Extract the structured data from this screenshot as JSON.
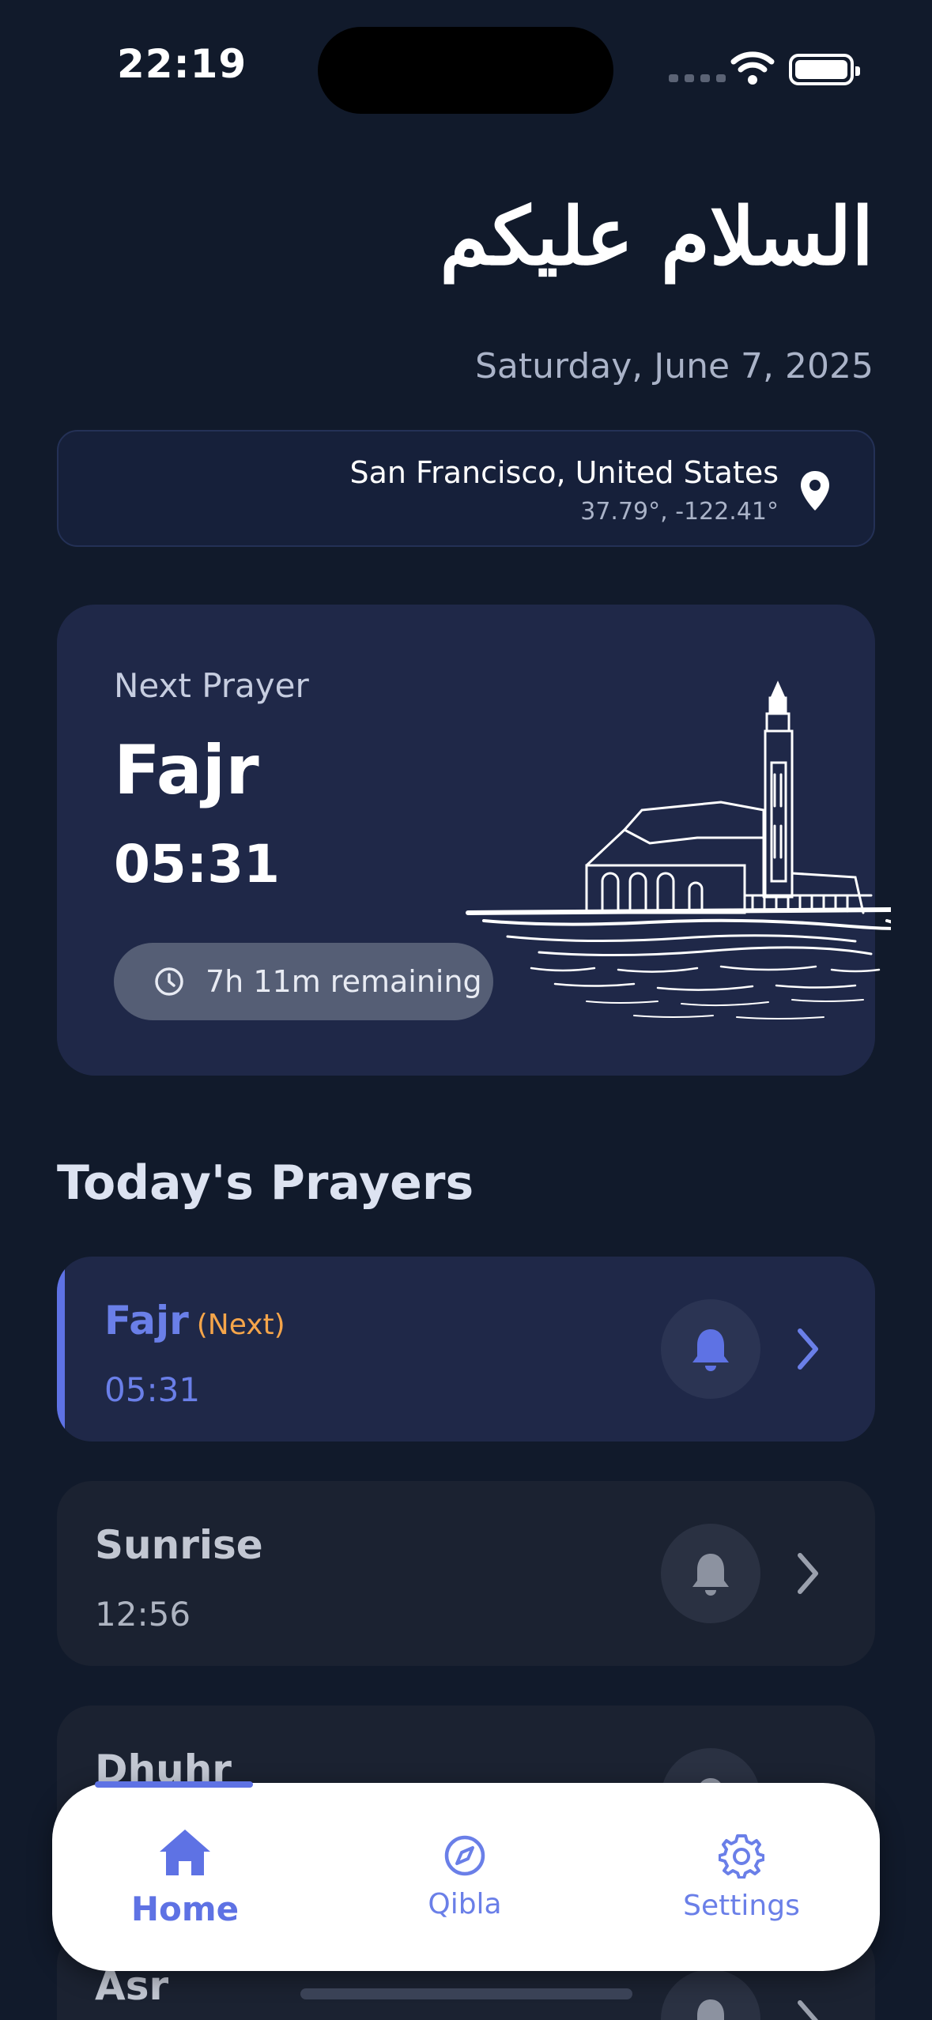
{
  "status_bar": {
    "time": "22:19"
  },
  "header": {
    "greeting": "السلام عليكم",
    "date": "Saturday, June 7, 2025"
  },
  "location": {
    "city": "San Francisco, United States",
    "coords": "37.79°, -122.41°",
    "icon": "location-pin-icon"
  },
  "next_prayer": {
    "label": "Next Prayer",
    "name": "Fajr",
    "time": "05:31",
    "remaining": "7h 11m remaining",
    "icon": "clock-icon"
  },
  "todays_prayers": {
    "heading": "Today's Prayers",
    "items": [
      {
        "name": "Fajr",
        "tag": "(Next)",
        "time": "05:31",
        "active": true
      },
      {
        "name": "Sunrise",
        "tag": "",
        "time": "12:56",
        "active": false
      },
      {
        "name": "Dhuhr",
        "tag": "",
        "time": "",
        "active": false
      },
      {
        "name": "Asr",
        "tag": "",
        "time": "",
        "active": false
      }
    ]
  },
  "tabbar": {
    "home": "Home",
    "qibla": "Qibla",
    "settings": "Settings",
    "selected": "Home"
  },
  "colors": {
    "background": "#111a2b",
    "card": "#1f2848",
    "accent": "#5e72e4",
    "next_tag": "#f5a54a"
  }
}
